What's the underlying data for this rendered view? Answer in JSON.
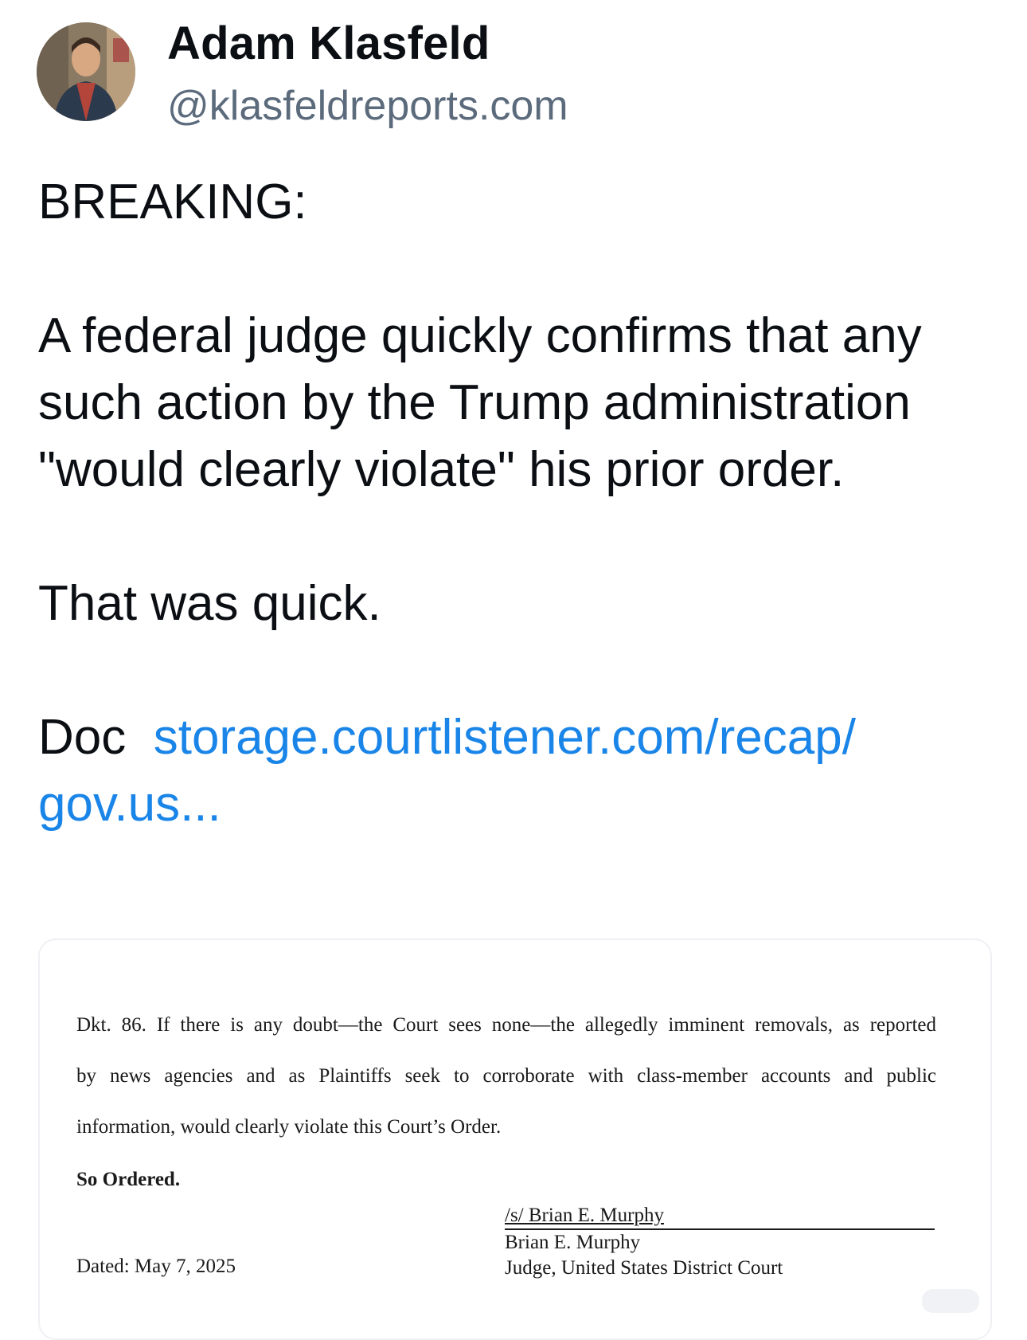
{
  "author": {
    "name": "Adam Klasfeld",
    "handle": "@klasfeldreports.com"
  },
  "post": {
    "line1": "BREAKING:",
    "paragraph": "A federal judge quickly confirms that any such action by the Trump administration \"would clearly violate\" his prior order.",
    "line3": "That was quick.",
    "doc_label": "Doc",
    "link_text_1": "storage.courtlistener.com/recap/",
    "link_text_2": "gov.us..."
  },
  "embed": {
    "doc_line1": "Dkt. 86.  If there is any doubt—the Court sees none—the allegedly imminent removals, as reported",
    "doc_line2": "by news agencies and as Plaintiffs seek to corroborate with class-member accounts and public",
    "doc_line3": "information, would clearly violate this Court’s Order.",
    "so_ordered": "So Ordered.",
    "signature": "/s/ Brian E. Murphy",
    "judge_name": "Brian E. Murphy",
    "judge_title": "Judge, United States District Court",
    "dated": "Dated:  May 7, 2025"
  },
  "colors": {
    "link": "#1a85e8",
    "handle": "#5b6b7c",
    "text": "#0b0f14"
  }
}
